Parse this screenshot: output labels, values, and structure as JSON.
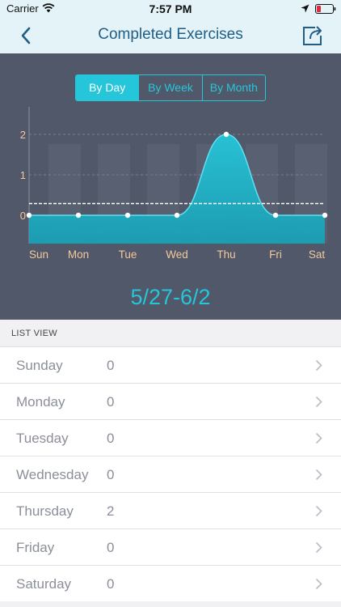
{
  "status_bar": {
    "carrier": "Carrier",
    "time": "7:57 PM"
  },
  "nav": {
    "title": "Completed Exercises",
    "back_icon": "chevron-left-icon",
    "share_icon": "share-icon"
  },
  "segments": {
    "items": [
      "By Day",
      "By Week",
      "By Month"
    ],
    "selected": "By Day"
  },
  "chart_data": {
    "type": "area",
    "categories": [
      "Sun",
      "Mon",
      "Tue",
      "Wed",
      "Thu",
      "Fri",
      "Sat"
    ],
    "values": [
      0,
      0,
      0,
      0,
      2,
      0,
      0
    ],
    "yticks": [
      0,
      1,
      2
    ],
    "ylim": [
      0,
      2
    ],
    "average": 0.29,
    "title": "",
    "xlabel": "",
    "ylabel": ""
  },
  "range_label": "5/27-6/2",
  "list": {
    "header": "LIST VIEW",
    "rows": [
      {
        "day": "Sunday",
        "count": "0"
      },
      {
        "day": "Monday",
        "count": "0"
      },
      {
        "day": "Tuesday",
        "count": "0"
      },
      {
        "day": "Wednesday",
        "count": "0"
      },
      {
        "day": "Thursday",
        "count": "2"
      },
      {
        "day": "Friday",
        "count": "0"
      },
      {
        "day": "Saturday",
        "count": "0"
      }
    ]
  },
  "colors": {
    "accent": "#26c6da",
    "nav_title": "#1f5f86",
    "chart_bg": "#50586a",
    "tick_label": "#f5c89a"
  }
}
